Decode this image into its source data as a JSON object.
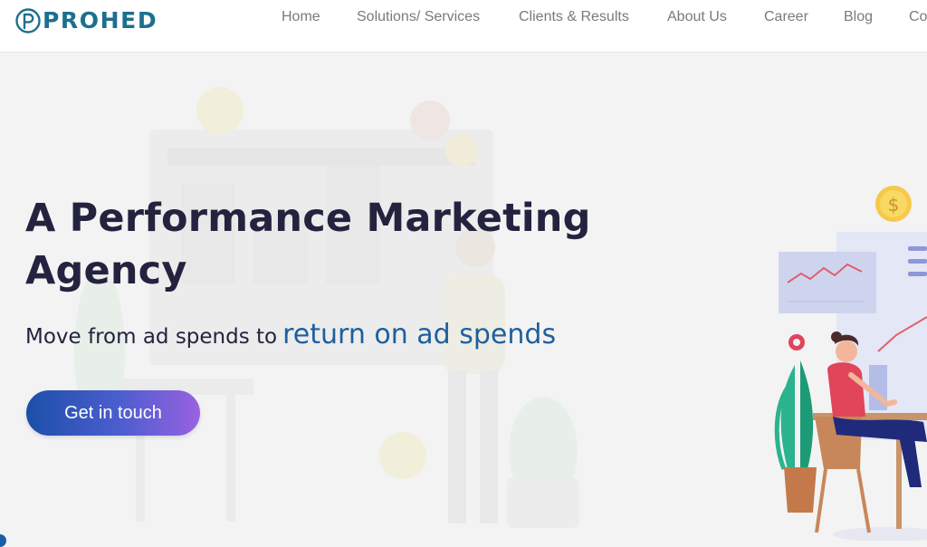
{
  "header": {
    "logo_text": "PROHED",
    "nav": [
      {
        "label": "Home"
      },
      {
        "label": "Solutions/ Services"
      },
      {
        "label": "Clients & Results"
      },
      {
        "label": "About Us"
      },
      {
        "label": "Career"
      },
      {
        "label": "Blog"
      },
      {
        "label": "Contact Us"
      }
    ]
  },
  "hero": {
    "title": "A Performance Marketing Agency",
    "subtitle_lead": "Move from ad spends to",
    "subtitle_accent": "return on ad spends",
    "cta_label": "Get in touch",
    "coin_symbol": "$"
  },
  "colors": {
    "brand": "#1d6f8f",
    "heading": "#24233f",
    "accent_text": "#1f5f9e",
    "nav_text": "#7a7a7a",
    "cta_gradient_start": "#1c4fa8",
    "cta_gradient_end": "#9a61e0",
    "background": "#f3f3f3"
  },
  "icons": [
    "prohed-logo-icon",
    "dollar-coin-icon",
    "line-chart-icon",
    "menu-bars-icon",
    "flower-icon",
    "plant-icon",
    "woman-at-desk-illustration"
  ]
}
